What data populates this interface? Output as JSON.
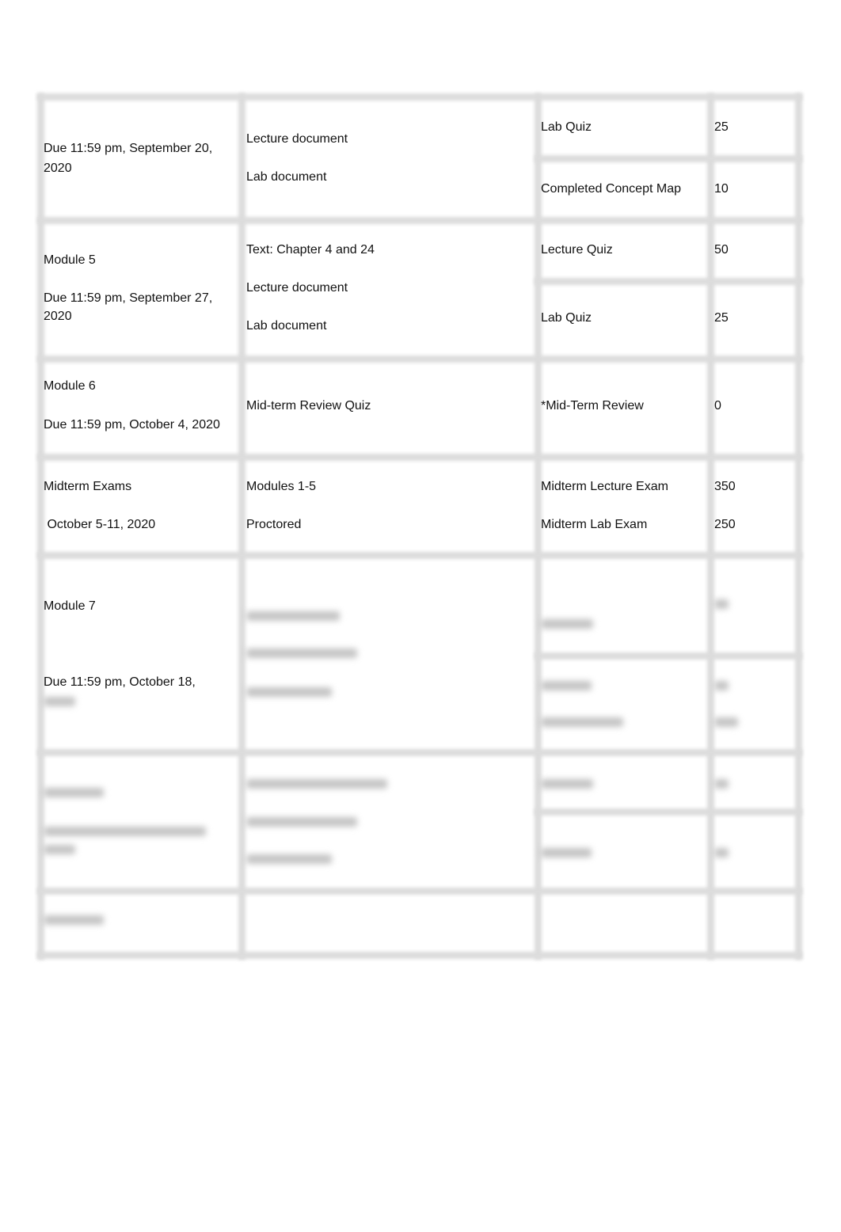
{
  "table": {
    "rows": [
      {
        "col1": [
          "Due 11:59 pm, September 20,",
          "2020"
        ],
        "col2": [
          "Lecture document",
          "Lab document"
        ],
        "items": [
          {
            "name": "Lab Quiz",
            "points": "25"
          },
          {
            "name": "Completed Concept Map",
            "points": "10"
          }
        ]
      },
      {
        "col1": [
          "Module 5",
          "Due 11:59 pm, September 27,",
          "2020"
        ],
        "col2": [
          "Text: Chapter 4 and 24",
          "Lecture document",
          "Lab document"
        ],
        "items": [
          {
            "name": "Lecture Quiz",
            "points": "50"
          },
          {
            "name": "Lab Quiz",
            "points": "25"
          }
        ]
      },
      {
        "col1": [
          "Module 6",
          "Due 11:59 pm, October 4, 2020"
        ],
        "col2": [
          "Mid-term Review Quiz"
        ],
        "items": [
          {
            "name": "*Mid-Term Review",
            "points": "0"
          }
        ]
      },
      {
        "col1": [
          "Midterm Exams",
          " October 5-11, 2020"
        ],
        "col2": [
          "Modules 1-5",
          "Proctored"
        ],
        "items": [
          {
            "name": "Midterm Lecture Exam",
            "points": "350"
          },
          {
            "name": "Midterm Lab Exam",
            "points": "250"
          }
        ]
      },
      {
        "col1": [
          "Module 7",
          "Due 11:59 pm, October 18,"
        ]
      }
    ],
    "blurred_note": "remaining content obscured"
  }
}
